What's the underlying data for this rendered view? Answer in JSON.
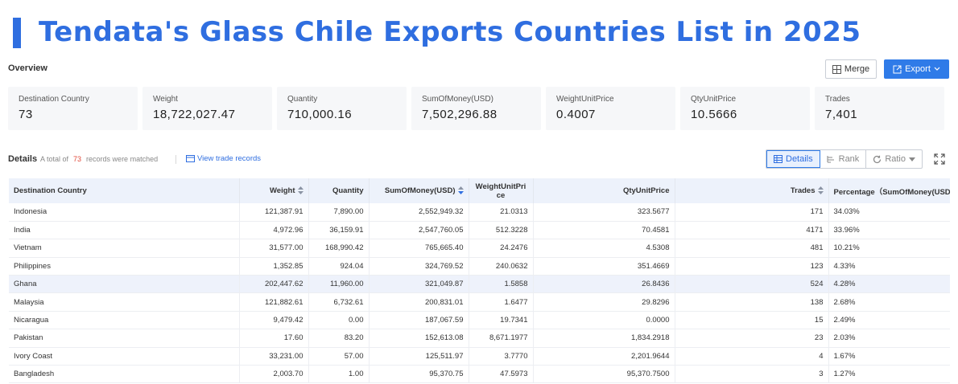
{
  "title": "Tendata's Glass Chile Exports Countries List in 2025",
  "overview": {
    "label": "Overview",
    "merge_label": "Merge",
    "export_label": "Export",
    "stats": [
      {
        "label": "Destination Country",
        "value": "73"
      },
      {
        "label": "Weight",
        "value": "18,722,027.47"
      },
      {
        "label": "Quantity",
        "value": "710,000.16"
      },
      {
        "label": "SumOfMoney(USD)",
        "value": "7,502,296.88"
      },
      {
        "label": "WeightUnitPrice",
        "value": "0.4007"
      },
      {
        "label": "QtyUnitPrice",
        "value": "10.5666"
      },
      {
        "label": "Trades",
        "value": "7,401"
      }
    ]
  },
  "details": {
    "label": "Details",
    "records_prefix": "A total of",
    "records_count": "73",
    "records_suffix": "records were matched",
    "view_link": "View trade records",
    "views": [
      "Details",
      "Rank",
      "Ratio"
    ]
  },
  "table": {
    "headers": [
      "Destination Country",
      "Weight",
      "Quantity",
      "SumOfMoney(USD)",
      "WeightUnitPrice",
      "QtyUnitPrice",
      "Trades",
      "Percentage（SumOfMoney(USD)"
    ],
    "rows": [
      [
        "Indonesia",
        "121,387.91",
        "7,890.00",
        "2,552,949.32",
        "21.0313",
        "323.5677",
        "171",
        "34.03%"
      ],
      [
        "India",
        "4,972.96",
        "36,159.91",
        "2,547,760.05",
        "512.3228",
        "70.4581",
        "4171",
        "33.96%"
      ],
      [
        "Vietnam",
        "31,577.00",
        "168,990.42",
        "765,665.40",
        "24.2476",
        "4.5308",
        "481",
        "10.21%"
      ],
      [
        "Philippines",
        "1,352.85",
        "924.04",
        "324,769.52",
        "240.0632",
        "351.4669",
        "123",
        "4.33%"
      ],
      [
        "Ghana",
        "202,447.62",
        "11,960.00",
        "321,049.87",
        "1.5858",
        "26.8436",
        "524",
        "4.28%"
      ],
      [
        "Malaysia",
        "121,882.61",
        "6,732.61",
        "200,831.01",
        "1.6477",
        "29.8296",
        "138",
        "2.68%"
      ],
      [
        "Nicaragua",
        "9,479.42",
        "0.00",
        "187,067.59",
        "19.7341",
        "0.0000",
        "15",
        "2.49%"
      ],
      [
        "Pakistan",
        "17.60",
        "83.20",
        "152,613.08",
        "8,671.1977",
        "1,834.2918",
        "23",
        "2.03%"
      ],
      [
        "Ivory Coast",
        "33,231.00",
        "57.00",
        "125,511.97",
        "3.7770",
        "2,201.9644",
        "4",
        "1.67%"
      ],
      [
        "Bangladesh",
        "2,003.70",
        "1.00",
        "95,370.75",
        "47.5973",
        "95,370.7500",
        "3",
        "1.27%"
      ]
    ]
  }
}
